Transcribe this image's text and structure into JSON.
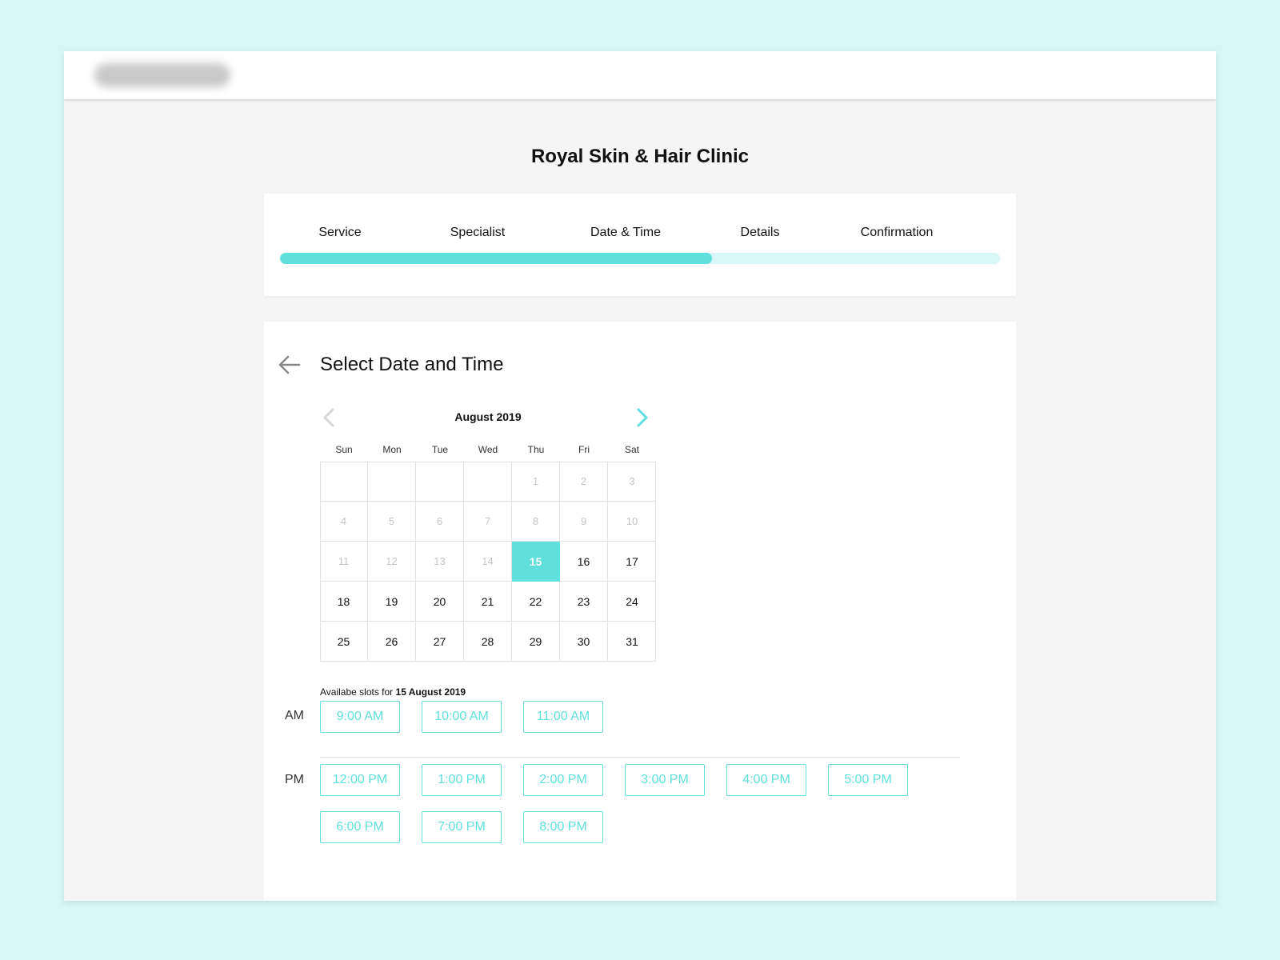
{
  "clinic": {
    "name": "Royal Skin & Hair Clinic"
  },
  "steps": [
    {
      "label": "Service"
    },
    {
      "label": "Specialist"
    },
    {
      "label": "Date & Time"
    },
    {
      "label": "Details"
    },
    {
      "label": "Confirmation"
    }
  ],
  "progress": {
    "fraction": 0.6
  },
  "colors": {
    "accent": "#5fe0dc",
    "accent_light": "#d8f6f5",
    "background": "#f5f5f5"
  },
  "section": {
    "title": "Select Date and Time",
    "back_icon": "arrow-left-icon"
  },
  "calendar": {
    "month": "August 2019",
    "prev_icon": "chevron-left-icon",
    "next_icon": "chevron-right-icon",
    "weekdays": [
      "Sun",
      "Mon",
      "Tue",
      "Wed",
      "Thu",
      "Fri",
      "Sat"
    ],
    "weeks": [
      [
        "",
        "",
        "",
        "",
        "1",
        "2",
        "3"
      ],
      [
        "4",
        "5",
        "6",
        "7",
        "8",
        "9",
        "10"
      ],
      [
        "11",
        "12",
        "13",
        "14",
        "15",
        "16",
        "17"
      ],
      [
        "18",
        "19",
        "20",
        "21",
        "22",
        "23",
        "24"
      ],
      [
        "25",
        "26",
        "27",
        "28",
        "29",
        "30",
        "31"
      ]
    ],
    "disabled_days": [
      "1",
      "2",
      "3",
      "4",
      "5",
      "6",
      "7",
      "8",
      "9",
      "10",
      "11",
      "12",
      "13",
      "14"
    ],
    "selected_day": "15"
  },
  "slots": {
    "caption_prefix": "Availabe slots for",
    "caption_date": "15 August 2019",
    "am_label": "AM",
    "pm_label": "PM",
    "am": [
      "9:00 AM",
      "10:00 AM",
      "11:00 AM"
    ],
    "pm": [
      "12:00 PM",
      "1:00 PM",
      "2:00 PM",
      "3:00 PM",
      "4:00 PM",
      "5:00 PM",
      "6:00 PM",
      "7:00 PM",
      "8:00 PM"
    ]
  }
}
